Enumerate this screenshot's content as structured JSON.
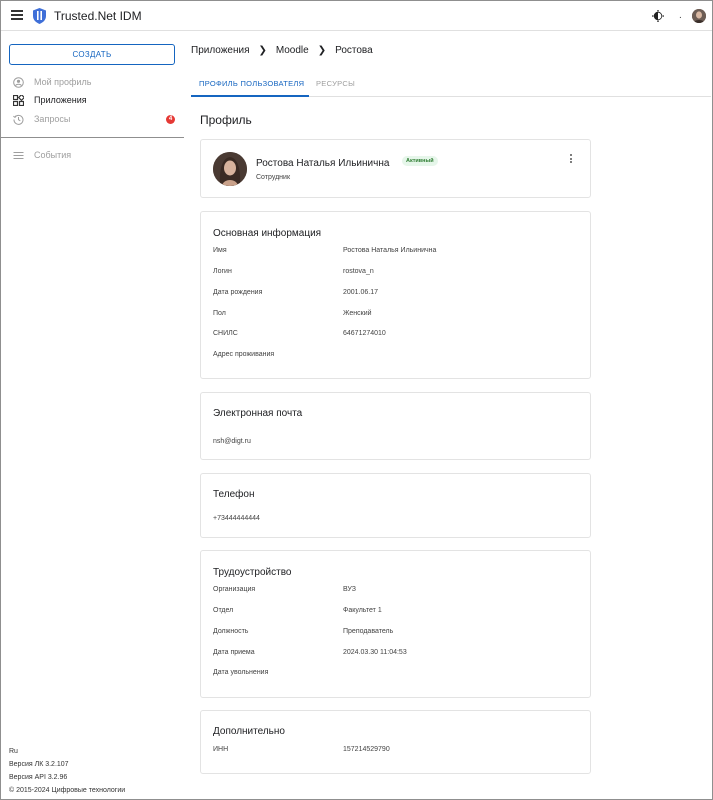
{
  "app": {
    "title": "Trusted.Net IDM"
  },
  "icons": {
    "menu": "menu-icon",
    "logo": "shield-logo-icon",
    "theme": "brightness-icon",
    "more": "more-vert-icon"
  },
  "colors": {
    "accent": "#1565c0",
    "badge": "#e53935",
    "status_bg": "#e6f6ea",
    "status_text": "#2e7d32"
  },
  "header": {
    "separator": "."
  },
  "sidebar": {
    "create_label": "СОЗДАТЬ",
    "items": [
      {
        "label": "Мой профиль",
        "icon": "account-circle-icon"
      },
      {
        "label": "Приложения",
        "icon": "apps-grid-icon"
      },
      {
        "label": "Запросы",
        "icon": "history-icon",
        "badge": "4"
      },
      {
        "label": "События",
        "icon": "list-icon"
      }
    ],
    "footer": {
      "lang": "Ru",
      "version_lk": "Версия ЛК 3.2.107",
      "version_api": "Версия API 3.2.96",
      "copyright": "© 2015-2024 Цифровые технологии"
    }
  },
  "breadcrumb": [
    "Приложения",
    "Moodle",
    "Ростова"
  ],
  "tabs": [
    {
      "label": "ПРОФИЛЬ ПОЛЬЗОВАТЕЛЯ",
      "active": true
    },
    {
      "label": "РЕСУРСЫ",
      "active": false
    }
  ],
  "page_title": "Профиль",
  "profile": {
    "name": "Ростова Наталья Ильинична",
    "status": "Активный",
    "role": "Сотрудник"
  },
  "basic_info": {
    "title": "Основная информация",
    "rows": [
      {
        "label": "Имя",
        "value": "Ростова Наталья Ильинична"
      },
      {
        "label": "Логин",
        "value": "rostova_n"
      },
      {
        "label": "Дата рождения",
        "value": "2001.06.17"
      },
      {
        "label": "Пол",
        "value": "Женский"
      },
      {
        "label": "СНИЛС",
        "value": "64671274010"
      },
      {
        "label": "Адрес проживания",
        "value": ""
      }
    ]
  },
  "email": {
    "title": "Электронная почта",
    "value": "nsh@digt.ru"
  },
  "phone": {
    "title": "Телефон",
    "value": "+73444444444"
  },
  "employment": {
    "title": "Трудоустройство",
    "rows": [
      {
        "label": "Организация",
        "value": "ВУЗ"
      },
      {
        "label": "Отдел",
        "value": "Факультет 1"
      },
      {
        "label": "Должность",
        "value": "Преподаватель"
      },
      {
        "label": "Дата приема",
        "value": "2024.03.30 11:04:53"
      },
      {
        "label": "Дата увольнения",
        "value": ""
      }
    ]
  },
  "additional": {
    "title": "Дополнительно",
    "rows": [
      {
        "label": "ИНН",
        "value": "157214529790"
      }
    ]
  }
}
